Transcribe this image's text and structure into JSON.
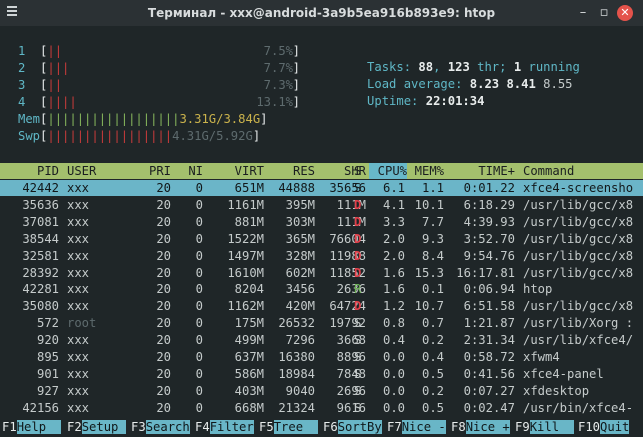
{
  "window": {
    "title": "Терминал - xxx@android-3a9b5ea916b893e9: htop"
  },
  "meters": {
    "cpus": [
      {
        "label": "1",
        "percent": "7.5%",
        "red": "||",
        "green": ""
      },
      {
        "label": "2",
        "percent": "7.7%",
        "red": "|||",
        "green": ""
      },
      {
        "label": "3",
        "percent": "7.3%",
        "red": "||",
        "green": ""
      },
      {
        "label": "4",
        "percent": "13.1%",
        "red": "||||",
        "green": ""
      }
    ],
    "mem": {
      "label": "Mem",
      "bar": "||||||||||||||||||",
      "value": "3.31G/",
      "total": "3.84G"
    },
    "swp": {
      "label": "Swp",
      "bar": "|||||||||||||||||",
      "value": "4.31G/5.92G"
    }
  },
  "summary": {
    "tasks_label": "Tasks: ",
    "tasks": "88",
    "sep": ", ",
    "thr": "123",
    "thr_label": " thr; ",
    "running": "1",
    "running_label": " running",
    "load_label": "Load average: ",
    "load1": "8.23",
    "load5": "8.41",
    "load15": "8.55",
    "uptime_label": "Uptime: ",
    "uptime": "22:01:34"
  },
  "table": {
    "headers": [
      "PID",
      "USER",
      "PRI",
      "NI",
      "VIRT",
      "RES",
      "SHR",
      "S",
      "CPU%",
      "MEM%",
      "TIME+",
      "Command"
    ],
    "rows": [
      [
        "42442",
        "xxx",
        "20",
        "0",
        "651M",
        "44888",
        "35656",
        "S",
        "6.1",
        "1.1",
        "0:01.22",
        "xfce4-screensho"
      ],
      [
        "35636",
        "xxx",
        "20",
        "0",
        "1161M",
        "395M",
        "111M",
        "D",
        "4.1",
        "10.1",
        "6:18.29",
        "/usr/lib/gcc/x8"
      ],
      [
        "37081",
        "xxx",
        "20",
        "0",
        "881M",
        "303M",
        "111M",
        "D",
        "3.3",
        "7.7",
        "4:39.93",
        "/usr/lib/gcc/x8"
      ],
      [
        "38544",
        "xxx",
        "20",
        "0",
        "1522M",
        "365M",
        "76604",
        "D",
        "2.0",
        "9.3",
        "3:52.70",
        "/usr/lib/gcc/x8"
      ],
      [
        "32581",
        "xxx",
        "20",
        "0",
        "1497M",
        "328M",
        "11988",
        "D",
        "2.0",
        "8.4",
        "9:54.76",
        "/usr/lib/gcc/x8"
      ],
      [
        "28392",
        "xxx",
        "20",
        "0",
        "1610M",
        "602M",
        "11852",
        "D",
        "1.6",
        "15.3",
        "16:17.81",
        "/usr/lib/gcc/x8"
      ],
      [
        "42281",
        "xxx",
        "20",
        "0",
        "8204",
        "3456",
        "2636",
        "R",
        "1.6",
        "0.1",
        "0:06.94",
        "htop"
      ],
      [
        "35080",
        "xxx",
        "20",
        "0",
        "1162M",
        "420M",
        "64724",
        "D",
        "1.2",
        "10.7",
        "6:51.58",
        "/usr/lib/gcc/x8"
      ],
      [
        "572",
        "root",
        "20",
        "0",
        "175M",
        "26532",
        "19792",
        "S",
        "0.8",
        "0.7",
        "1:21.87",
        "/usr/lib/Xorg :"
      ],
      [
        "920",
        "xxx",
        "20",
        "0",
        "499M",
        "7296",
        "3668",
        "S",
        "0.4",
        "0.2",
        "2:31.34",
        "/usr/lib/xfce4/"
      ],
      [
        "895",
        "xxx",
        "20",
        "0",
        "637M",
        "16380",
        "8896",
        "S",
        "0.0",
        "0.4",
        "0:58.72",
        "xfwm4"
      ],
      [
        "901",
        "xxx",
        "20",
        "0",
        "586M",
        "18984",
        "7848",
        "S",
        "0.0",
        "0.5",
        "0:41.56",
        "xfce4-panel"
      ],
      [
        "927",
        "xxx",
        "20",
        "0",
        "403M",
        "9040",
        "2696",
        "S",
        "0.0",
        "0.2",
        "0:07.27",
        "xfdesktop"
      ],
      [
        "42156",
        "xxx",
        "20",
        "0",
        "668M",
        "21324",
        "9616",
        "S",
        "0.0",
        "0.5",
        "0:02.47",
        "/usr/bin/xfce4-"
      ]
    ]
  },
  "fkeys": [
    {
      "key": "F1",
      "label": "Help  "
    },
    {
      "key": "F2",
      "label": "Setup "
    },
    {
      "key": "F3",
      "label": "Search"
    },
    {
      "key": "F4",
      "label": "Filter"
    },
    {
      "key": "F5",
      "label": "Tree  "
    },
    {
      "key": "F6",
      "label": "SortBy"
    },
    {
      "key": "F7",
      "label": "Nice -"
    },
    {
      "key": "F8",
      "label": "Nice +"
    },
    {
      "key": "F9",
      "label": "Kill  "
    },
    {
      "key": "F10",
      "label": "Quit"
    }
  ],
  "colors": {
    "header_bar": "#a4c06d",
    "selection": "#6bb5c8",
    "state_d": "#e0404a",
    "state_r": "#6cb255",
    "close_button": "#e4534b"
  }
}
